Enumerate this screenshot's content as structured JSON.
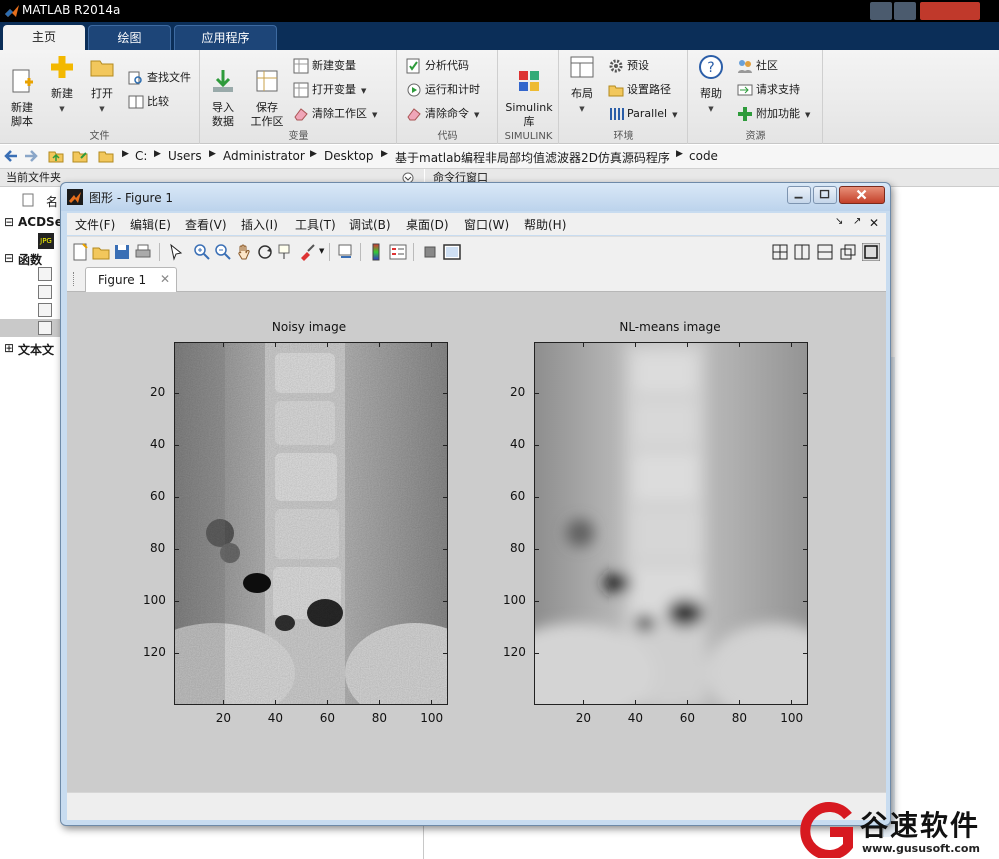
{
  "app": {
    "title": "MATLAB R2014a"
  },
  "tabs": [
    {
      "label": "主页"
    },
    {
      "label": "绘图"
    },
    {
      "label": "应用程序"
    }
  ],
  "ribbon": {
    "file": {
      "new_script": "新建\n脚本",
      "new": "新建",
      "open": "打开",
      "find_files": "查找文件",
      "compare": "比较",
      "label": "文件"
    },
    "variable": {
      "import": "导入\n数据",
      "save_ws": "保存\n工作区",
      "new_var": "新建变量",
      "open_var": "打开变量",
      "clear_ws": "清除工作区",
      "label": "变量"
    },
    "code": {
      "analyze": "分析代码",
      "run_time": "运行和计时",
      "clear_cmd": "清除命令",
      "label": "代码"
    },
    "simulink": {
      "lib": "Simulink\n库",
      "label": "SIMULINK"
    },
    "env": {
      "layout": "布局",
      "prefs": "预设",
      "set_path": "设置路径",
      "parallel": "Parallel",
      "label": "环境"
    },
    "resources": {
      "help": "帮助",
      "community": "社区",
      "support": "请求支持",
      "addons": "附加功能",
      "label": "资源"
    }
  },
  "address": {
    "crumbs": [
      "C:",
      "Users",
      "Administrator",
      "Desktop",
      "基于matlab编程非局部均值滤波器2D仿真源码程序",
      "code"
    ]
  },
  "left_panel": {
    "header": "当前文件夹",
    "col_name": "名",
    "tree": [
      "ACDSe",
      "函数",
      "文本文"
    ]
  },
  "command_window": {
    "header": "命令行窗口"
  },
  "figure": {
    "window_title": "图形 - Figure 1",
    "menu": [
      "文件(F)",
      "编辑(E)",
      "查看(V)",
      "插入(I)",
      "工具(T)",
      "调试(B)",
      "桌面(D)",
      "窗口(W)",
      "帮助(H)"
    ],
    "doc_tab": "Figure 1",
    "plots": [
      {
        "title": "Noisy image",
        "yticks": [
          "20",
          "40",
          "60",
          "80",
          "100",
          "120"
        ],
        "xticks": [
          "20",
          "40",
          "60",
          "80",
          "100"
        ]
      },
      {
        "title": "NL-means image",
        "yticks": [
          "20",
          "40",
          "60",
          "80",
          "100",
          "120"
        ],
        "xticks": [
          "20",
          "40",
          "60",
          "80",
          "100"
        ]
      }
    ]
  },
  "watermark": {
    "name": "谷速软件",
    "url": "www.gususoft.com"
  }
}
